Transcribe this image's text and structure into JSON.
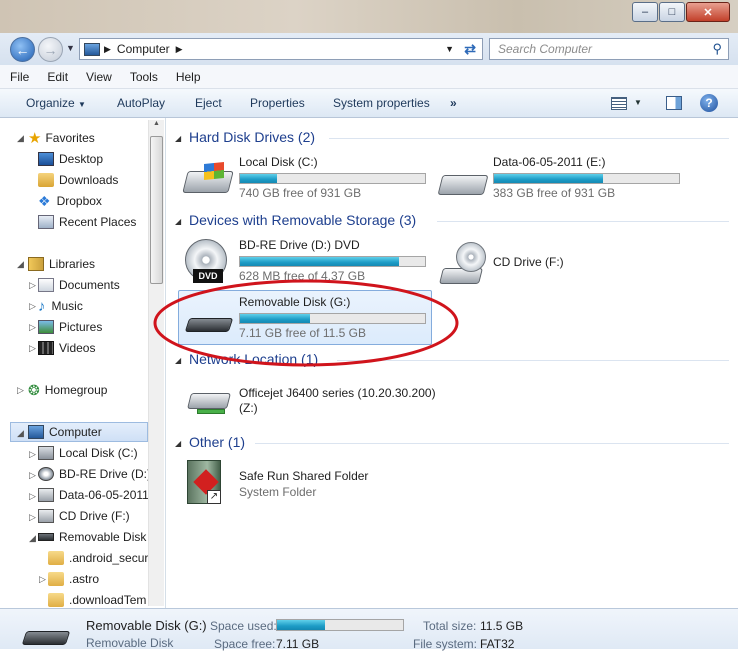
{
  "window": {
    "minimize": "–",
    "maximize": "□",
    "close": "✕"
  },
  "address": {
    "crumb": "Computer",
    "search_placeholder": "Search Computer"
  },
  "menu": [
    "File",
    "Edit",
    "View",
    "Tools",
    "Help"
  ],
  "toolbar": {
    "organize": "Organize",
    "autoplay": "AutoPlay",
    "eject": "Eject",
    "properties": "Properties",
    "system_properties": "System properties",
    "more": "»"
  },
  "nav": {
    "favorites": "Favorites",
    "desktop": "Desktop",
    "downloads": "Downloads",
    "dropbox": "Dropbox",
    "recent": "Recent Places",
    "libraries": "Libraries",
    "documents": "Documents",
    "music": "Music",
    "pictures": "Pictures",
    "videos": "Videos",
    "homegroup": "Homegroup",
    "computer": "Computer",
    "local_disk": "Local Disk (C:)",
    "bdre": "BD-RE Drive (D:)",
    "data": "Data-06-05-2011",
    "cd": "CD Drive (F:)",
    "removable": "Removable Disk (",
    "android": ".android_secure",
    "astro": ".astro",
    "download_temp": ".downloadTem"
  },
  "groups": {
    "hdd": "Hard Disk Drives (2)",
    "removable": "Devices with Removable Storage (3)",
    "network": "Network Location (1)",
    "other": "Other (1)"
  },
  "drives": {
    "c": {
      "name": "Local Disk (C:)",
      "free": "740 GB free of 931 GB",
      "used_fraction": 0.2
    },
    "e": {
      "name": "Data-06-05-2011 (E:)",
      "free": "383 GB free of 931 GB",
      "used_fraction": 0.59
    },
    "d": {
      "name": "BD-RE Drive (D:) DVD",
      "free": "628 MB free of 4.37 GB",
      "used_fraction": 0.86,
      "badge": "DVD"
    },
    "f": {
      "name": "CD Drive (F:)"
    },
    "g": {
      "name": "Removable Disk (G:)",
      "free": "7.11 GB free of 11.5 GB",
      "used_fraction": 0.38
    },
    "printer": {
      "name": "Officejet J6400 series (10.20.30.200)",
      "name2": "(Z:)"
    },
    "saferun": {
      "name": "Safe Run Shared Folder",
      "sub": "System Folder"
    }
  },
  "status": {
    "name": "Removable Disk (G:)",
    "type": "Removable Disk",
    "space_used_label": "Space used:",
    "space_used_fraction": 0.38,
    "space_free_label": "Space free:",
    "space_free": "7.11 GB",
    "total_label": "Total size:",
    "total": "11.5 GB",
    "fs_label": "File system:",
    "fs": "FAT32"
  },
  "colors": {
    "accent": "#1e3f8e",
    "bar_fill": "#1d9cc6",
    "highlight": "#d0141c"
  }
}
